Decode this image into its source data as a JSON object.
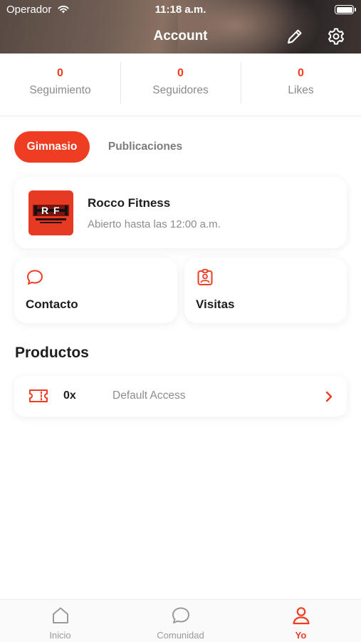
{
  "status_bar": {
    "carrier": "Operador",
    "time": "11:18 a.m."
  },
  "header": {
    "title": "Account",
    "edit_icon": "pencil-icon",
    "settings_icon": "gear-icon"
  },
  "stats": [
    {
      "value": "0",
      "label": "Seguimiento"
    },
    {
      "value": "0",
      "label": "Seguidores"
    },
    {
      "value": "0",
      "label": "Likes"
    }
  ],
  "tabs": [
    {
      "label": "Gimnasio",
      "active": true
    },
    {
      "label": "Publicaciones",
      "active": false
    }
  ],
  "gym": {
    "name": "Rocco Fitness",
    "hours": "Abierto hasta las 12:00 a.m."
  },
  "actions": [
    {
      "label": "Contacto",
      "icon": "chat-bubble-icon"
    },
    {
      "label": "Visitas",
      "icon": "visitor-badge-icon"
    }
  ],
  "products": {
    "title": "Productos",
    "items": [
      {
        "quantity": "0x",
        "name": "Default Access",
        "icon": "ticket-icon"
      }
    ]
  },
  "nav": [
    {
      "label": "Inicio",
      "icon": "home-icon",
      "active": false
    },
    {
      "label": "Comunidad",
      "icon": "chat-bubble-icon",
      "active": false
    },
    {
      "label": "Yo",
      "icon": "user-icon",
      "active": true
    }
  ],
  "colors": {
    "accent": "#ee3d23",
    "muted_text": "#8d8d8d",
    "heading_text": "#1d1d1f"
  }
}
